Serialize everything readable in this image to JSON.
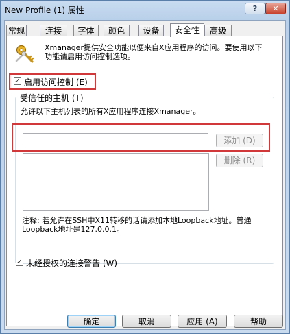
{
  "window": {
    "title": "New Profile (1) 属性",
    "help_label": "?",
    "close_label": "✕"
  },
  "tabs": [
    {
      "label": "常规"
    },
    {
      "label": "连接"
    },
    {
      "label": "字体"
    },
    {
      "label": "颜色"
    },
    {
      "label": "设备"
    },
    {
      "label": "安全性",
      "active": true
    },
    {
      "label": "高级"
    }
  ],
  "security": {
    "icon": "keys-icon",
    "description_line1": "Xmanager提供安全功能以便来自X应用程序的访问。要使用以下",
    "description_line2": "功能请启用访问控制选项。",
    "enable_access_control": {
      "label": "启用访问控制 (E)",
      "checked": true
    },
    "trusted_hosts": {
      "group_title": "受信任的主机 (T)",
      "instruction": "允许以下主机列表的所有X应用程序连接Xmanager。",
      "host_input_value": "",
      "add_label": "添加 (D)",
      "remove_label": "删除 (R)",
      "hosts": [],
      "note_line1": "注释: 若允许在SSH中X11转移的话请添加本地Loopback地址。普通",
      "note_line2": "Loopback地址是127.0.0.1。"
    },
    "unauthorized_warning": {
      "label": "未经授权的连接警告 (W)",
      "checked": true
    }
  },
  "buttons": {
    "ok": "确定",
    "cancel": "取消",
    "apply": "应用 (A)",
    "help": "帮助"
  },
  "colors": {
    "highlight_box": "#d0383a",
    "title_bar": "#b9d0ea",
    "close_button": "#c7412c"
  }
}
